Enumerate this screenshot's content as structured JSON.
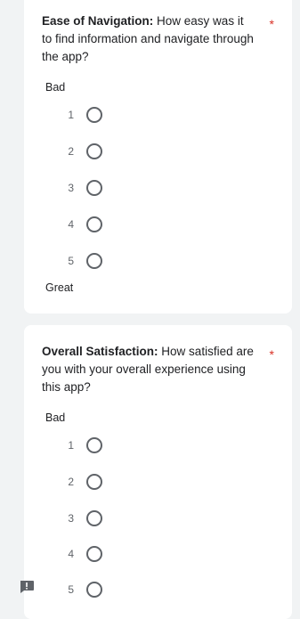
{
  "questions": [
    {
      "title_bold": "Ease of Navigation:",
      "title_rest": " How easy was it to find information and navigate through the app?",
      "required_mark": "*",
      "low_label": "Bad",
      "high_label": "Great",
      "options": [
        "1",
        "2",
        "3",
        "4",
        "5"
      ]
    },
    {
      "title_bold": "Overall Satisfaction:",
      "title_rest": " How satisfied are you with your overall experience using this app?",
      "required_mark": "*",
      "low_label": "Bad",
      "options": [
        "1",
        "2",
        "3",
        "4",
        "5"
      ]
    }
  ],
  "icons": {
    "report": "report-issue-icon"
  },
  "colors": {
    "background": "#f1f3f4",
    "card": "#ffffff",
    "required": "#d93025",
    "radio_border": "#5f6368"
  }
}
